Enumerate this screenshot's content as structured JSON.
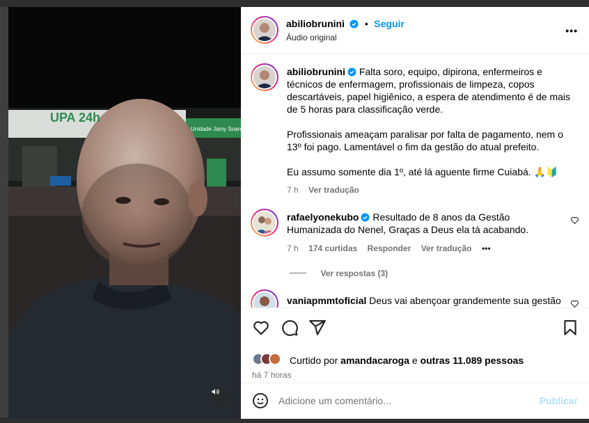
{
  "post": {
    "username": "abiliobrunini",
    "follow_label": "Seguir",
    "audio": "Áudio original",
    "more_label": "•••"
  },
  "caption": {
    "username": "abiliobrunini",
    "para1": "Falta soro, equipo, dipirona, enfermeiros e técnicos de enfermagem, profissionais de limpeza, copos descartáveis, papel higiênico, a espera de atendimento é de mais de 5 horas para classificação verde.",
    "para2": "Profissionais ameaçam paralisar por falta de pagamento, nem o 13º foi pago. Lamentável o fim da gestão do atual prefeito.",
    "para3": "Eu assumo somente dia 1º, até lá aguente firme Cuiabá. 🙏🔰",
    "time": "7 h",
    "translate": "Ver tradução"
  },
  "comments": [
    {
      "username": "rafaelyonekubo",
      "text": "Resultado de 8 anos da Gestão Humanizada do Nenel, Graças a Deus ela tá acabando.",
      "time": "7 h",
      "likes": "174 curtidas",
      "reply": "Responder",
      "translate": "Ver tradução",
      "more": "•••",
      "view_replies": "Ver respostas (3)"
    },
    {
      "username": "vaniapmmtoficial",
      "text": "Deus vai abençoar grandemente sua gestão"
    }
  ],
  "likes": {
    "prefix": "Curtido por ",
    "user": "amandacaroga",
    "middle": " e ",
    "others": "outras 11.089 pessoas",
    "time": "há 7 horas"
  },
  "add_comment": {
    "placeholder": "Adicione um comentário...",
    "publish": "Publicar"
  },
  "video_sign": {
    "brand": "UPA 24h",
    "unit": "Unidade Jamy Soares Ra"
  },
  "colors": {
    "accent": "#0095f6",
    "verified": "#0095f6",
    "publish_disabled": "#b2dffc"
  }
}
